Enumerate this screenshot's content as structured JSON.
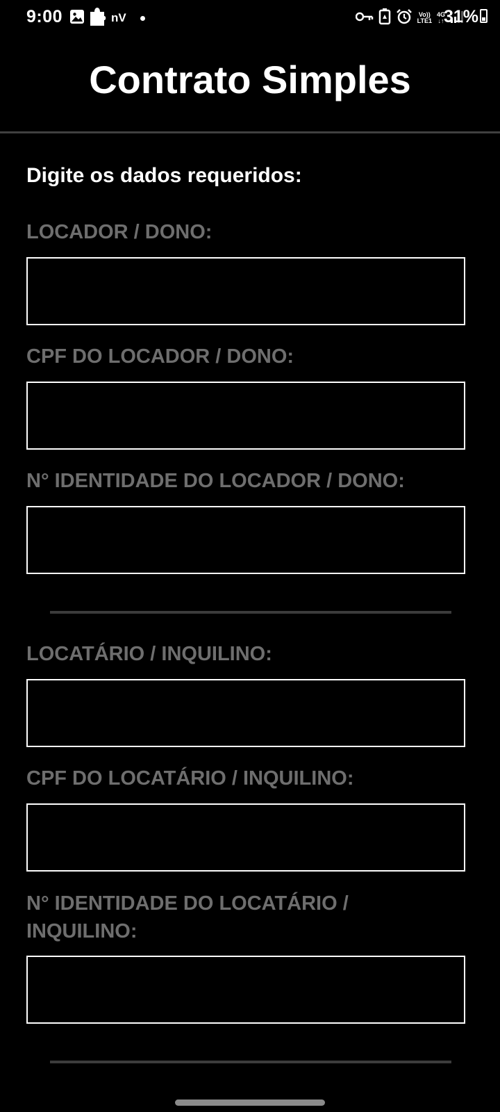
{
  "status_bar": {
    "time": "9:00",
    "carrier_label": "nV",
    "network_volte": "Vo))",
    "network_lte": "LTE1",
    "network_4g": "4G",
    "battery_percent": "31%",
    "left_icons": [
      "image-icon",
      "puzzle-icon"
    ],
    "right_icons": [
      "key-icon",
      "battery-saver-icon",
      "alarm-icon",
      "signal-icon"
    ]
  },
  "app_bar": {
    "title": "Contrato Simples"
  },
  "form": {
    "instructions": "Digite os dados requeridos:",
    "landlord": {
      "name_label": "LOCADOR / DONO:",
      "name_value": "",
      "cpf_label": "CPF DO LOCADOR / DONO:",
      "cpf_value": "",
      "id_label": "N° IDENTIDADE DO LOCADOR / DONO:",
      "id_value": ""
    },
    "tenant": {
      "name_label": "LOCATÁRIO / INQUILINO:",
      "name_value": "",
      "cpf_label": "CPF DO LOCATÁRIO / INQUILINO:",
      "cpf_value": "",
      "id_label": "N° IDENTIDADE DO LOCATÁRIO / INQUILINO:",
      "id_value": ""
    }
  },
  "colors": {
    "background": "#000000",
    "title": "#ffffff",
    "label": "#6e6e6e",
    "input_border": "#ffffff",
    "divider": "#3c3c3c"
  }
}
